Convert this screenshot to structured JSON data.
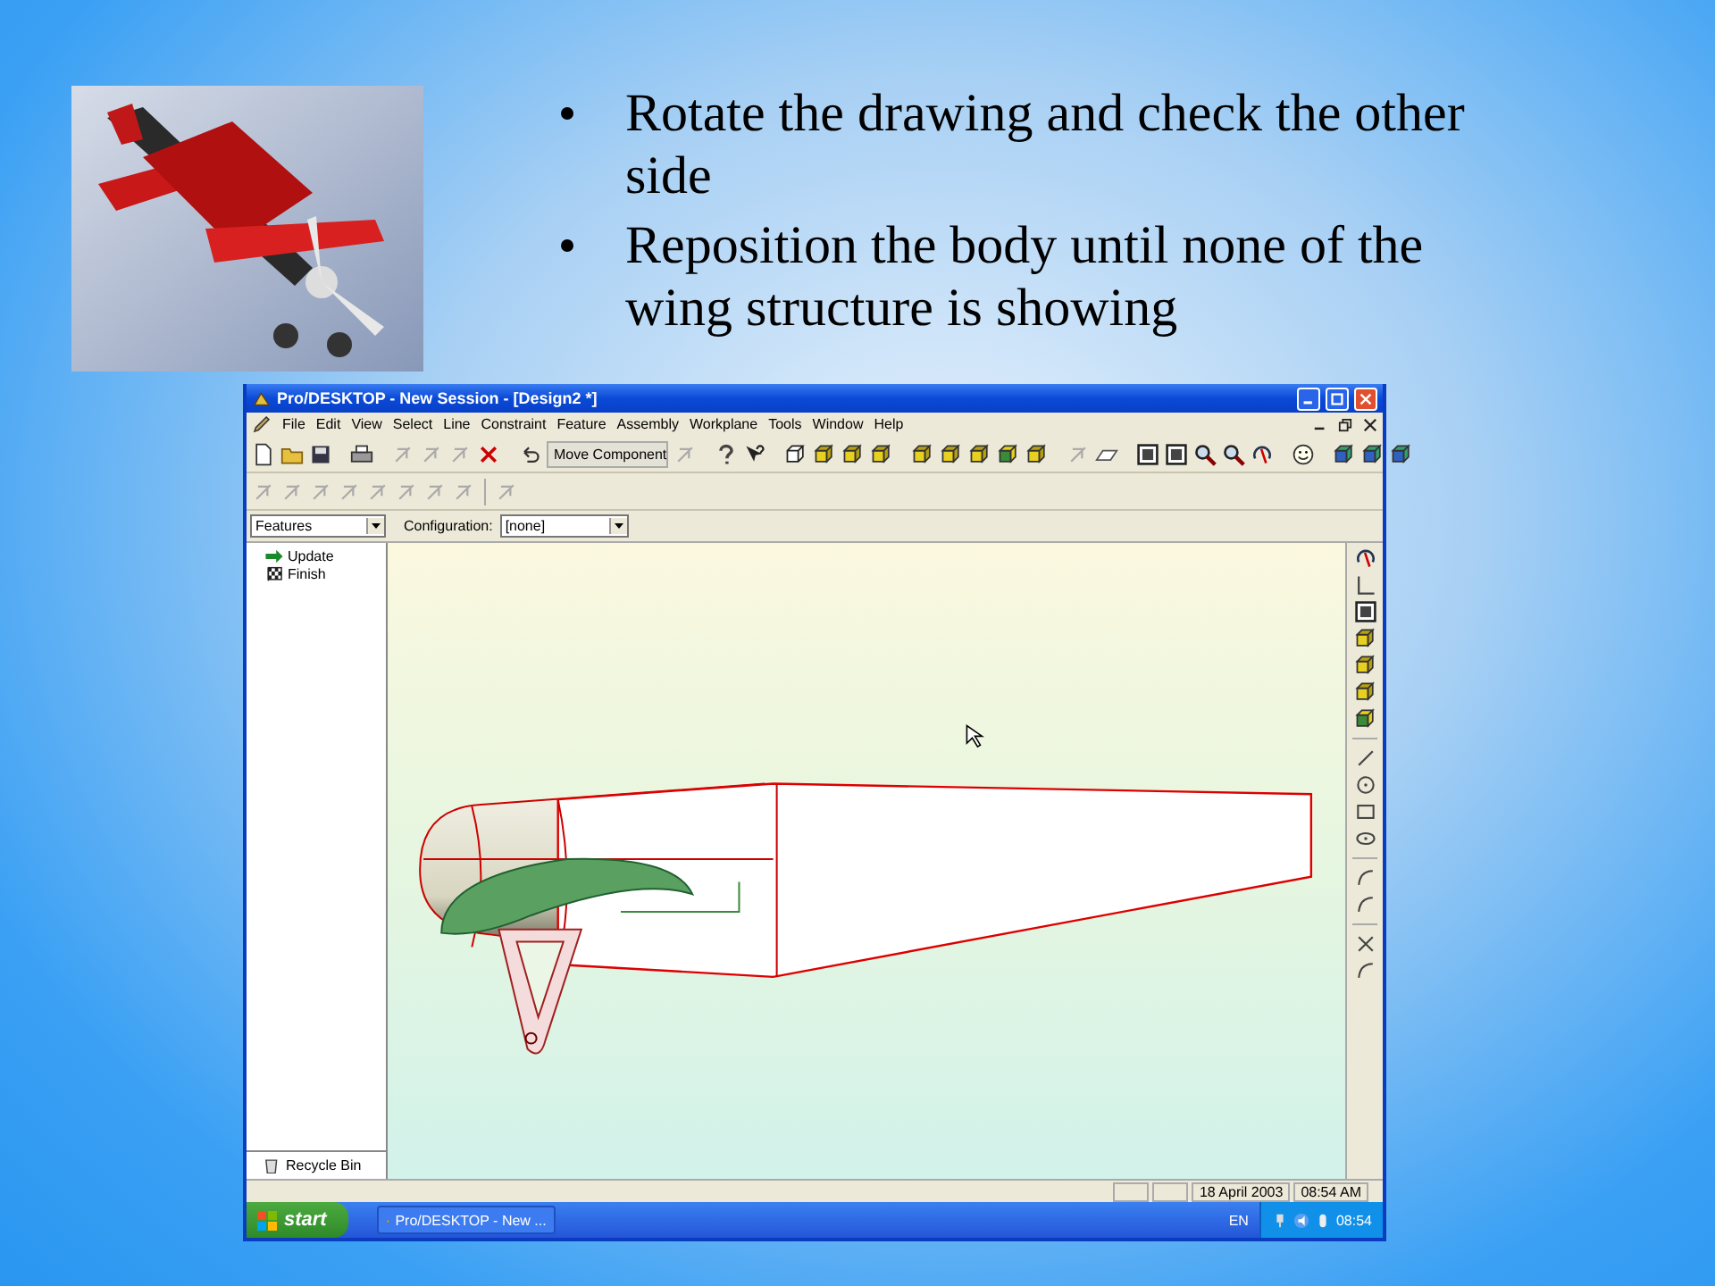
{
  "slide": {
    "bullets": [
      "Rotate the drawing and check the other side",
      "Reposition the body until none of the wing structure is showing"
    ]
  },
  "window": {
    "title": "Pro/DESKTOP - New Session - [Design2 *]"
  },
  "menu": [
    "File",
    "Edit",
    "View",
    "Select",
    "Line",
    "Constraint",
    "Feature",
    "Assembly",
    "Workplane",
    "Tools",
    "Window",
    "Help"
  ],
  "toolbar": {
    "command_field": "Move Component"
  },
  "browser": {
    "view_dropdown": "Features",
    "tree": [
      {
        "label": "Update",
        "kind": "arrow"
      },
      {
        "label": "Finish",
        "kind": "flag"
      }
    ],
    "recycle_bin": "Recycle Bin"
  },
  "configuration": {
    "label": "Configuration:",
    "value": "[none]"
  },
  "status_bar": {
    "date": "18 April 2003",
    "time": "08:54 AM"
  },
  "taskbar": {
    "start": "start",
    "task": "Pro/DESKTOP - New ...",
    "language": "EN",
    "clock": "08:54"
  }
}
